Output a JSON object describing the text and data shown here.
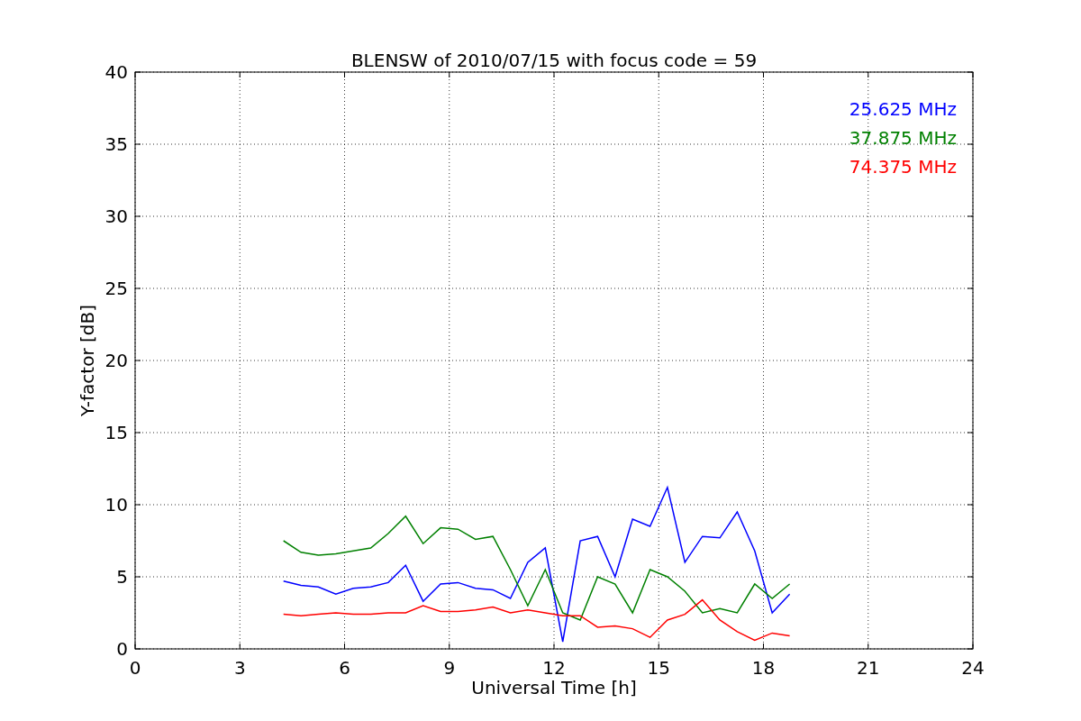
{
  "chart_data": {
    "type": "line",
    "title": "BLENSW of 2010/07/15 with focus code = 59",
    "xlabel": "Universal Time [h]",
    "ylabel": "Y-factor [dB]",
    "grid": true,
    "xlim": [
      0,
      24
    ],
    "ylim": [
      0,
      40
    ],
    "xticks": [
      0,
      3,
      6,
      9,
      12,
      15,
      18,
      21,
      24
    ],
    "yticks": [
      0,
      5,
      10,
      15,
      20,
      25,
      30,
      35,
      40
    ],
    "x": [
      4.25,
      4.75,
      5.25,
      5.75,
      6.25,
      6.75,
      7.25,
      7.75,
      8.25,
      8.75,
      9.25,
      9.75,
      10.25,
      10.75,
      11.25,
      11.75,
      12.25,
      12.75,
      13.25,
      13.75,
      14.25,
      14.75,
      15.25,
      15.75,
      16.25,
      16.75,
      17.25,
      17.75,
      18.25,
      18.75
    ],
    "series": [
      {
        "name": "25.625 MHz",
        "color": "#0000ff",
        "values": [
          4.7,
          4.4,
          4.3,
          3.8,
          4.2,
          4.3,
          4.6,
          5.8,
          3.3,
          4.5,
          4.6,
          4.2,
          4.1,
          3.5,
          6,
          7,
          0.5,
          7.5,
          7.8,
          5,
          9,
          8.5,
          11.2,
          6,
          7.8,
          7.7,
          9.5,
          6.8,
          2.5,
          3.8
        ]
      },
      {
        "name": "37.875 MHz",
        "color": "#008000",
        "values": [
          7.5,
          6.7,
          6.5,
          6.6,
          6.8,
          7,
          8,
          9.2,
          7.3,
          8.4,
          8.3,
          7.6,
          7.8,
          5.5,
          3,
          5.5,
          2.5,
          2,
          5,
          4.5,
          2.5,
          5.5,
          5,
          4,
          2.5,
          2.8,
          2.5,
          4.5,
          3.5,
          4.5
        ]
      },
      {
        "name": "74.375 MHz",
        "color": "#ff0000",
        "values": [
          2.4,
          2.3,
          2.4,
          2.5,
          2.4,
          2.4,
          2.5,
          2.5,
          3,
          2.6,
          2.6,
          2.7,
          2.9,
          2.5,
          2.7,
          2.5,
          2.3,
          2.3,
          1.5,
          1.6,
          1.4,
          0.8,
          2,
          2.4,
          3.4,
          2,
          1.2,
          0.6,
          1.1,
          0.9
        ]
      }
    ]
  }
}
